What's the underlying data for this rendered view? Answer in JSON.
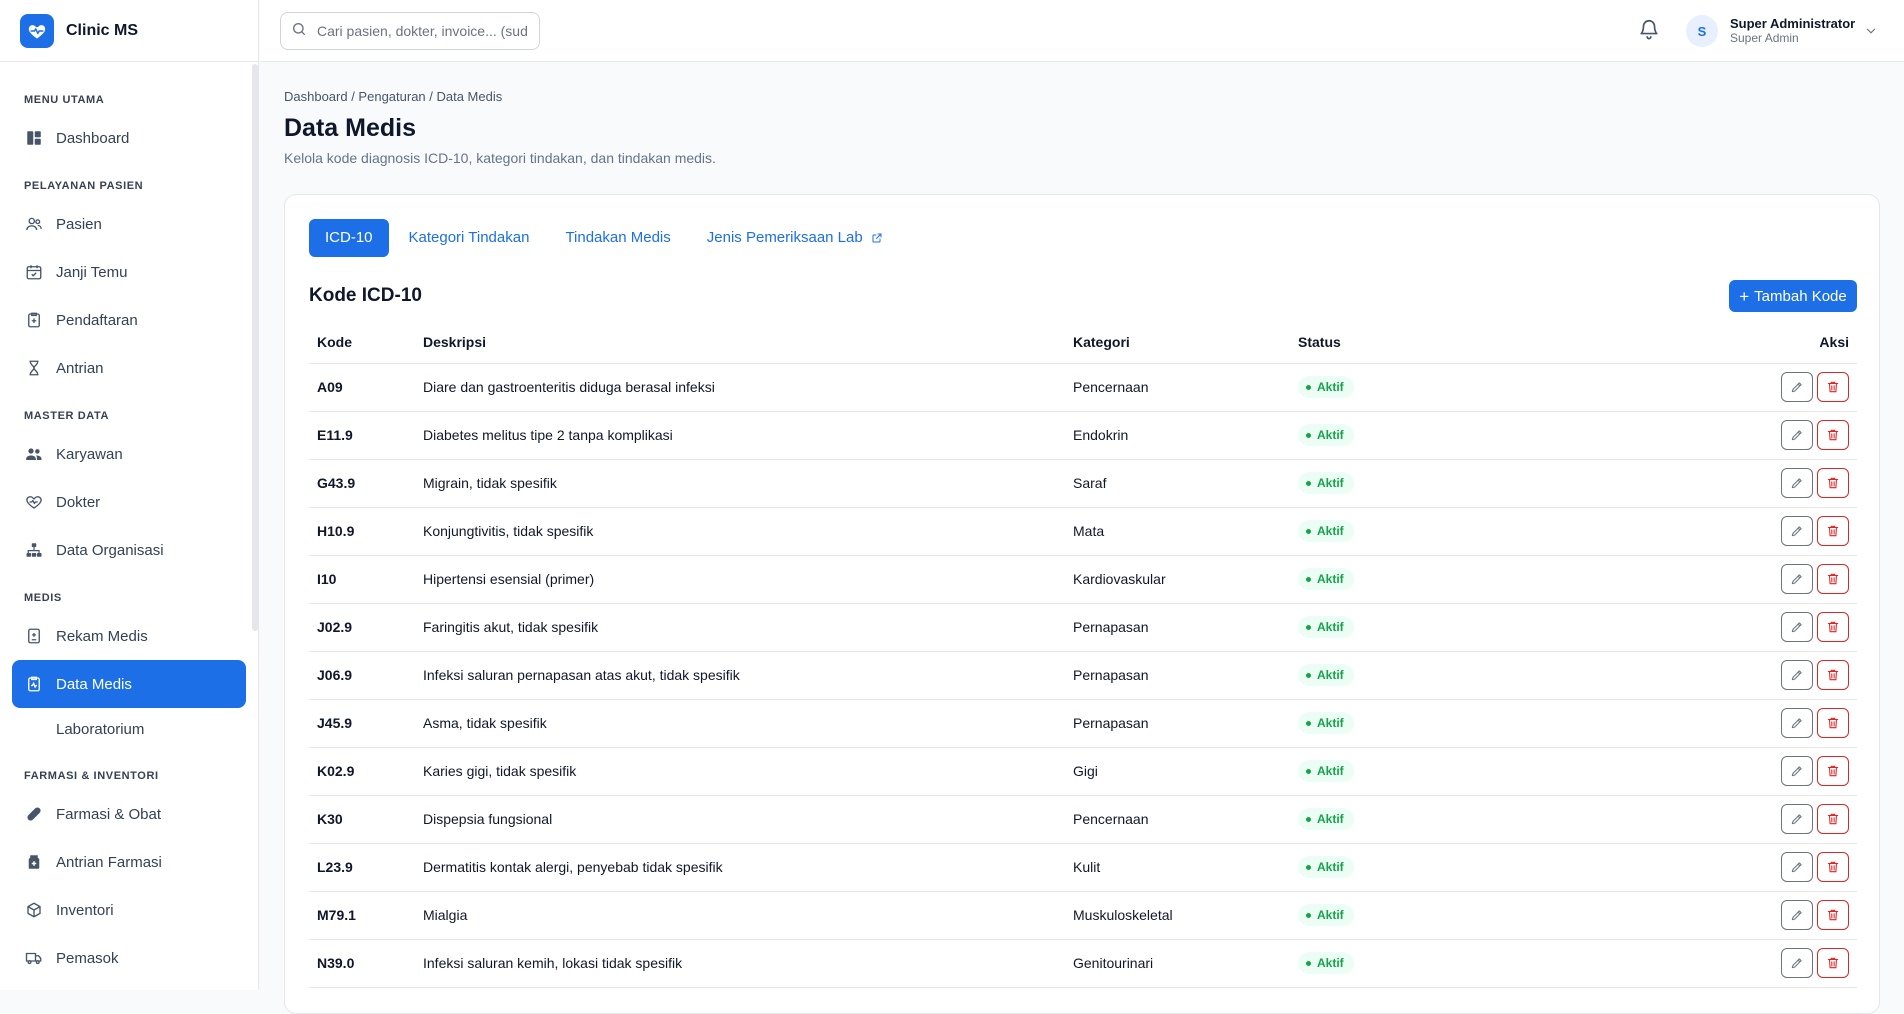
{
  "app": {
    "name": "Clinic MS"
  },
  "search": {
    "placeholder": "Cari pasien, dokter, invoice... (sudah)"
  },
  "user": {
    "initial": "S",
    "name": "Super Administrator",
    "role": "Super Admin"
  },
  "sidebar": {
    "sections": [
      {
        "title": "MENU UTAMA",
        "items": [
          {
            "label": "Dashboard",
            "icon": "dashboard-icon"
          }
        ]
      },
      {
        "title": "PELAYANAN PASIEN",
        "items": [
          {
            "label": "Pasien",
            "icon": "users-icon"
          },
          {
            "label": "Janji Temu",
            "icon": "calendar-icon"
          },
          {
            "label": "Pendaftaran",
            "icon": "clipboard-icon"
          },
          {
            "label": "Antrian",
            "icon": "hourglass-icon"
          }
        ]
      },
      {
        "title": "MASTER DATA",
        "items": [
          {
            "label": "Karyawan",
            "icon": "employees-icon"
          },
          {
            "label": "Dokter",
            "icon": "heart-pulse-icon"
          },
          {
            "label": "Data Organisasi",
            "icon": "org-chart-icon"
          }
        ]
      },
      {
        "title": "MEDIS",
        "items": [
          {
            "label": "Rekam Medis",
            "icon": "medical-record-icon"
          },
          {
            "label": "Data Medis",
            "icon": "medical-data-icon",
            "active": true
          },
          {
            "label": "Laboratorium",
            "sub": true
          }
        ]
      },
      {
        "title": "FARMASI & INVENTORI",
        "items": [
          {
            "label": "Farmasi & Obat",
            "icon": "pill-icon"
          },
          {
            "label": "Antrian Farmasi",
            "icon": "pharmacy-queue-icon"
          },
          {
            "label": "Inventori",
            "icon": "box-icon"
          },
          {
            "label": "Pemasok",
            "icon": "truck-icon"
          }
        ]
      }
    ]
  },
  "page": {
    "breadcrumb": "Dashboard / Pengaturan / Data Medis",
    "title": "Data Medis",
    "subtitle": "Kelola kode diagnosis ICD-10, kategori tindakan, dan tindakan medis."
  },
  "tabs": [
    {
      "label": "ICD-10",
      "active": true
    },
    {
      "label": "Kategori Tindakan"
    },
    {
      "label": "Tindakan Medis"
    },
    {
      "label": "Jenis Pemeriksaan Lab",
      "external": true
    }
  ],
  "card": {
    "title": "Kode ICD-10",
    "add_label": "Tambah Kode"
  },
  "table": {
    "headers": {
      "kode": "Kode",
      "deskripsi": "Deskripsi",
      "kategori": "Kategori",
      "status": "Status",
      "aksi": "Aksi"
    },
    "rows": [
      {
        "kode": "A09",
        "deskripsi": "Diare dan gastroenteritis diduga berasal infeksi",
        "kategori": "Pencernaan",
        "status": "Aktif"
      },
      {
        "kode": "E11.9",
        "deskripsi": "Diabetes melitus tipe 2 tanpa komplikasi",
        "kategori": "Endokrin",
        "status": "Aktif"
      },
      {
        "kode": "G43.9",
        "deskripsi": "Migrain, tidak spesifik",
        "kategori": "Saraf",
        "status": "Aktif"
      },
      {
        "kode": "H10.9",
        "deskripsi": "Konjungtivitis, tidak spesifik",
        "kategori": "Mata",
        "status": "Aktif"
      },
      {
        "kode": "I10",
        "deskripsi": "Hipertensi esensial (primer)",
        "kategori": "Kardiovaskular",
        "status": "Aktif"
      },
      {
        "kode": "J02.9",
        "deskripsi": "Faringitis akut, tidak spesifik",
        "kategori": "Pernapasan",
        "status": "Aktif"
      },
      {
        "kode": "J06.9",
        "deskripsi": "Infeksi saluran pernapasan atas akut, tidak spesifik",
        "kategori": "Pernapasan",
        "status": "Aktif"
      },
      {
        "kode": "J45.9",
        "deskripsi": "Asma, tidak spesifik",
        "kategori": "Pernapasan",
        "status": "Aktif"
      },
      {
        "kode": "K02.9",
        "deskripsi": "Karies gigi, tidak spesifik",
        "kategori": "Gigi",
        "status": "Aktif"
      },
      {
        "kode": "K30",
        "deskripsi": "Dispepsia fungsional",
        "kategori": "Pencernaan",
        "status": "Aktif"
      },
      {
        "kode": "L23.9",
        "deskripsi": "Dermatitis kontak alergi, penyebab tidak spesifik",
        "kategori": "Kulit",
        "status": "Aktif"
      },
      {
        "kode": "M79.1",
        "deskripsi": "Mialgia",
        "kategori": "Muskuloskeletal",
        "status": "Aktif"
      },
      {
        "kode": "N39.0",
        "deskripsi": "Infeksi saluran kemih, lokasi tidak spesifik",
        "kategori": "Genitourinari",
        "status": "Aktif"
      }
    ]
  },
  "colors": {
    "primary": "#1d6fe8",
    "success": "#16a34a",
    "danger": "#dc2626"
  }
}
